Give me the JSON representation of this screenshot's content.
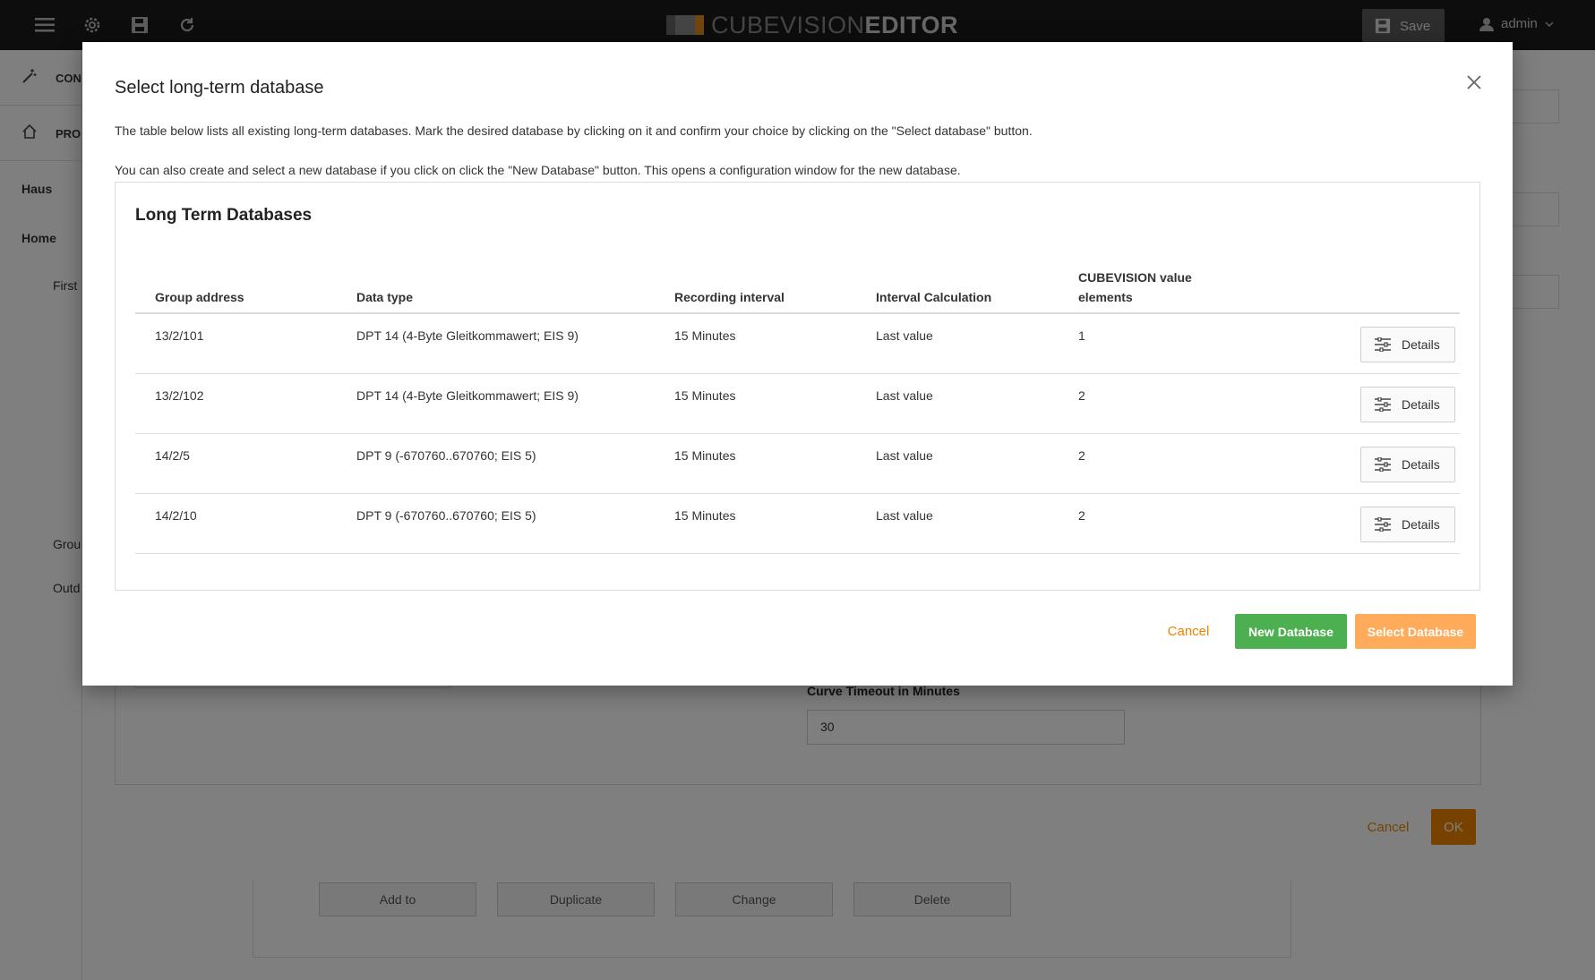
{
  "topbar": {
    "logo_part1": "CUBEVISION",
    "logo_part2": "EDITOR",
    "save_label": "Save",
    "user_label": "admin"
  },
  "leftnav": {
    "items": [
      {
        "label": "CON",
        "icon": "wand-icon"
      },
      {
        "label": "PRO",
        "icon": "home-icon"
      }
    ],
    "tree": [
      "Haus",
      "Home",
      "First",
      "Grou",
      "Outd"
    ]
  },
  "background_dialog": {
    "curve_timeout_label": "Curve Timeout in Minutes",
    "curve_timeout_value": "30",
    "cancel_label": "Cancel",
    "ok_label": "OK"
  },
  "background_actions": [
    "Add to",
    "Duplicate",
    "Change",
    "Delete"
  ],
  "modal": {
    "title": "Select long-term database",
    "description1": "The table below lists all existing long-term databases. Mark the desired database by clicking on it and confirm your choice by clicking on the \"Select database\" button.",
    "description2": "You can also create and select a new database if you click on click the \"New Database\" button. This opens a configuration window for the new database.",
    "card_title": "Long Term Databases",
    "columns": {
      "group_address": "Group address",
      "data_type": "Data type",
      "recording_interval": "Recording interval",
      "interval_calculation": "Interval Calculation",
      "value_elements_line1": "CUBEVISION value",
      "value_elements_line2": "elements"
    },
    "rows": [
      {
        "group_address": "13/2/101",
        "data_type": "DPT 14 (4-Byte Gleitkommawert; EIS 9)",
        "recording_interval": "15 Minutes",
        "interval_calculation": "Last value",
        "value_elements": "1",
        "details_label": "Details"
      },
      {
        "group_address": "13/2/102",
        "data_type": "DPT 14 (4-Byte Gleitkommawert; EIS 9)",
        "recording_interval": "15 Minutes",
        "interval_calculation": "Last value",
        "value_elements": "2",
        "details_label": "Details"
      },
      {
        "group_address": "14/2/5",
        "data_type": "DPT 9 (-670760..670760; EIS 5)",
        "recording_interval": "15 Minutes",
        "interval_calculation": "Last value",
        "value_elements": "2",
        "details_label": "Details"
      },
      {
        "group_address": "14/2/10",
        "data_type": "DPT 9 (-670760..670760; EIS 5)",
        "recording_interval": "15 Minutes",
        "interval_calculation": "Last value",
        "value_elements": "2",
        "details_label": "Details"
      }
    ],
    "cancel_label": "Cancel",
    "new_database_label": "New Database",
    "select_database_label": "Select Database"
  },
  "colors": {
    "accent_orange": "#ef8200",
    "select_disabled": "#ffab5a",
    "new_green": "#4caf50",
    "topbar": "#1b1b1b"
  }
}
